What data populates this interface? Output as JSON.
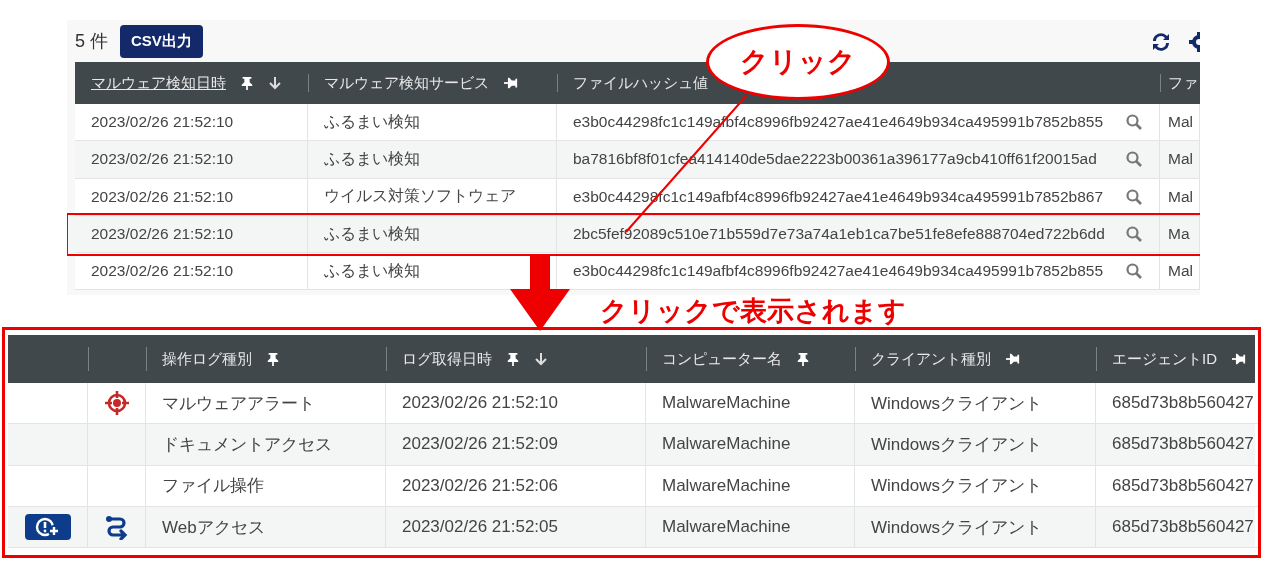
{
  "result_list": {
    "count": "5 件",
    "export_button": "CSV出力",
    "columns": [
      {
        "label": "マルウェア検知日時",
        "kind": "pinned",
        "sort_desc": true,
        "active": true
      },
      {
        "label": "マルウェア検知サービス",
        "kind": "unpinned",
        "sort_desc": false,
        "active": false
      },
      {
        "label": "ファイルハッシュ値",
        "kind": "lookup",
        "sort_desc": false,
        "active": false
      },
      {
        "label": "ファ",
        "kind": "plain",
        "sort_desc": false,
        "active": false
      }
    ],
    "rows": [
      {
        "cells": [
          "2023/02/26 21:52:10",
          "ふるまい検知",
          "e3b0c44298fc1c149afbf4c8996fb92427ae41e4649b934ca495991b7852b855",
          "Mal"
        ],
        "highlighted": false
      },
      {
        "cells": [
          "2023/02/26 21:52:10",
          "ふるまい検知",
          "ba7816bf8f01cfea414140de5dae2223b00361a396177a9cb410ff61f20015ad",
          "Mal"
        ],
        "highlighted": false
      },
      {
        "cells": [
          "2023/02/26 21:52:10",
          "ウイルス対策ソフトウェア",
          "e3b0c44298fc1c149afbf4c8996fb92427ae41e4649b934ca495991b7852b867",
          "Mal"
        ],
        "highlighted": false
      },
      {
        "cells": [
          "2023/02/26 21:52:10",
          "ふるまい検知",
          "2bc5fef92089c510e71b559d7e73a74a1eb1ca7be51fe8efe888704ed722b6dd",
          "Ma"
        ],
        "highlighted": true
      },
      {
        "cells": [
          "2023/02/26 21:52:10",
          "ふるまい検知",
          "e3b0c44298fc1c149afbf4c8996fb92427ae41e4649b934ca495991b7852b855",
          "Mal"
        ],
        "highlighted": false
      }
    ]
  },
  "annotations": {
    "callout": "クリック",
    "caption": "クリックで表示されます"
  },
  "operation_log": {
    "columns": [
      {
        "label": "操作ログ種別",
        "kind": "pinned",
        "sort_desc": false
      },
      {
        "label": "ログ取得日時",
        "kind": "pinned",
        "sort_desc": true
      },
      {
        "label": "コンピューター名",
        "kind": "pinned",
        "sort_desc": false
      },
      {
        "label": "クライアント種別",
        "kind": "unpinned",
        "sort_desc": false
      },
      {
        "label": "エージェントID",
        "kind": "unpinned",
        "sort_desc": false
      }
    ],
    "rows": [
      {
        "alert_button": false,
        "kind": "alert",
        "cells": [
          "マルウェアアラート",
          "2023/02/26 21:52:10",
          "MalwareMachine",
          "Windowsクライアント",
          "685d73b8b560427"
        ]
      },
      {
        "alert_button": false,
        "kind": "document",
        "cells": [
          "ドキュメントアクセス",
          "2023/02/26 21:52:09",
          "MalwareMachine",
          "Windowsクライアント",
          "685d73b8b560427"
        ]
      },
      {
        "alert_button": false,
        "kind": "file",
        "cells": [
          "ファイル操作",
          "2023/02/26 21:52:06",
          "MalwareMachine",
          "Windowsクライアント",
          "685d73b8b560427"
        ]
      },
      {
        "alert_button": true,
        "kind": "web",
        "cells": [
          "Webアクセス",
          "2023/02/26 21:52:05",
          "MalwareMachine",
          "Windowsクライアント",
          "685d73b8b560427"
        ]
      }
    ]
  }
}
